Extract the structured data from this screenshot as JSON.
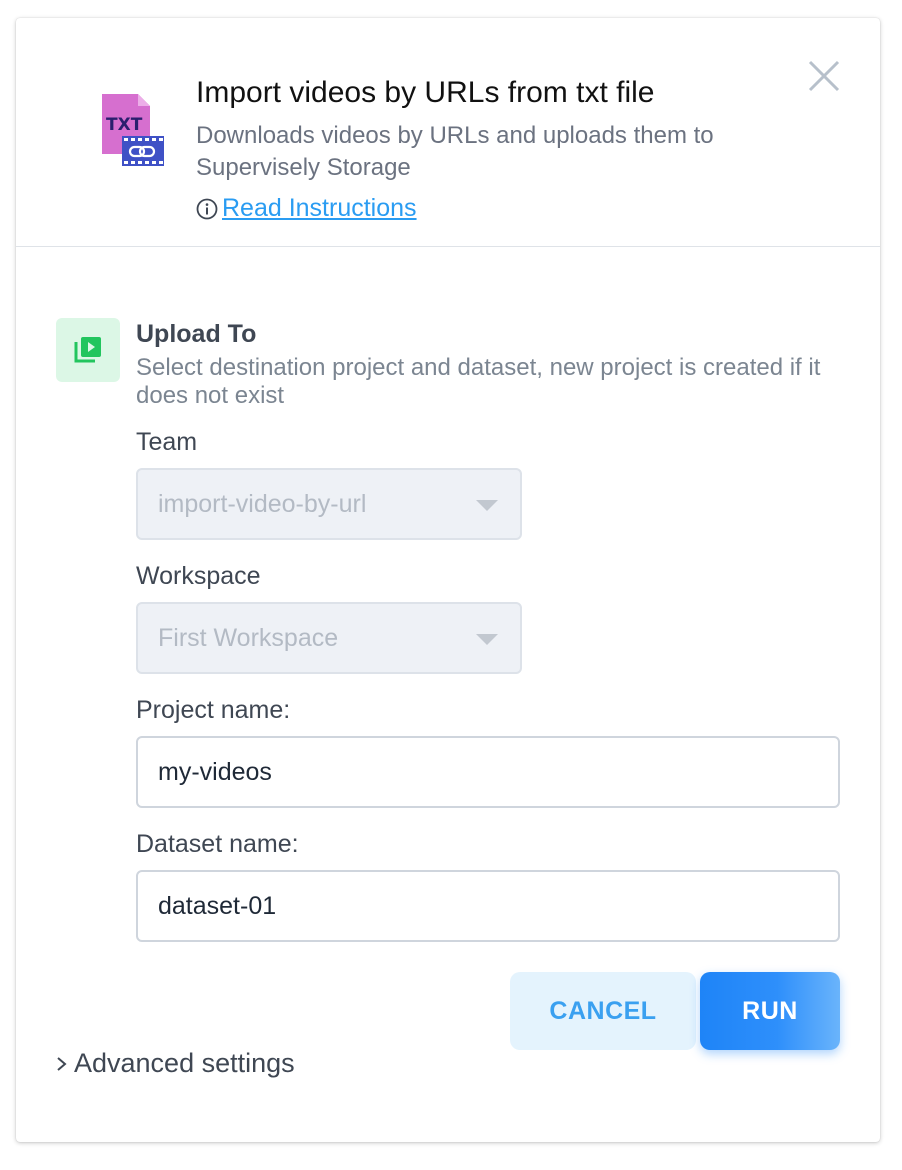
{
  "header": {
    "title": "Import videos by URLs from txt file",
    "description": "Downloads videos by URLs and uploads them to Supervisely Storage",
    "instructions_link": "Read Instructions",
    "icon_text": "TXT"
  },
  "section": {
    "title": "Upload To",
    "description": "Select destination project and dataset, new project is created if it does not exist"
  },
  "fields": {
    "team": {
      "label": "Team",
      "value": "import-video-by-url"
    },
    "workspace": {
      "label": "Workspace",
      "value": "First Workspace"
    },
    "project": {
      "label": "Project name:",
      "value": "my-videos"
    },
    "dataset": {
      "label": "Dataset name:",
      "value": "dataset-01"
    }
  },
  "buttons": {
    "cancel": "CANCEL",
    "run": "RUN"
  },
  "advanced": {
    "label": "Advanced settings"
  },
  "colors": {
    "accent": "#2a9cf2",
    "run_button": "#1e84f7",
    "section_icon_bg": "#dcf7e6",
    "section_icon": "#22c55e",
    "app_icon_file": "#d66fcf",
    "app_icon_film": "#3f51c6"
  },
  "icons": {
    "app": "txt-video-link-icon",
    "info": "info-icon",
    "close": "close-icon",
    "section": "video-play-icon",
    "advanced": "chevron-right-icon"
  }
}
